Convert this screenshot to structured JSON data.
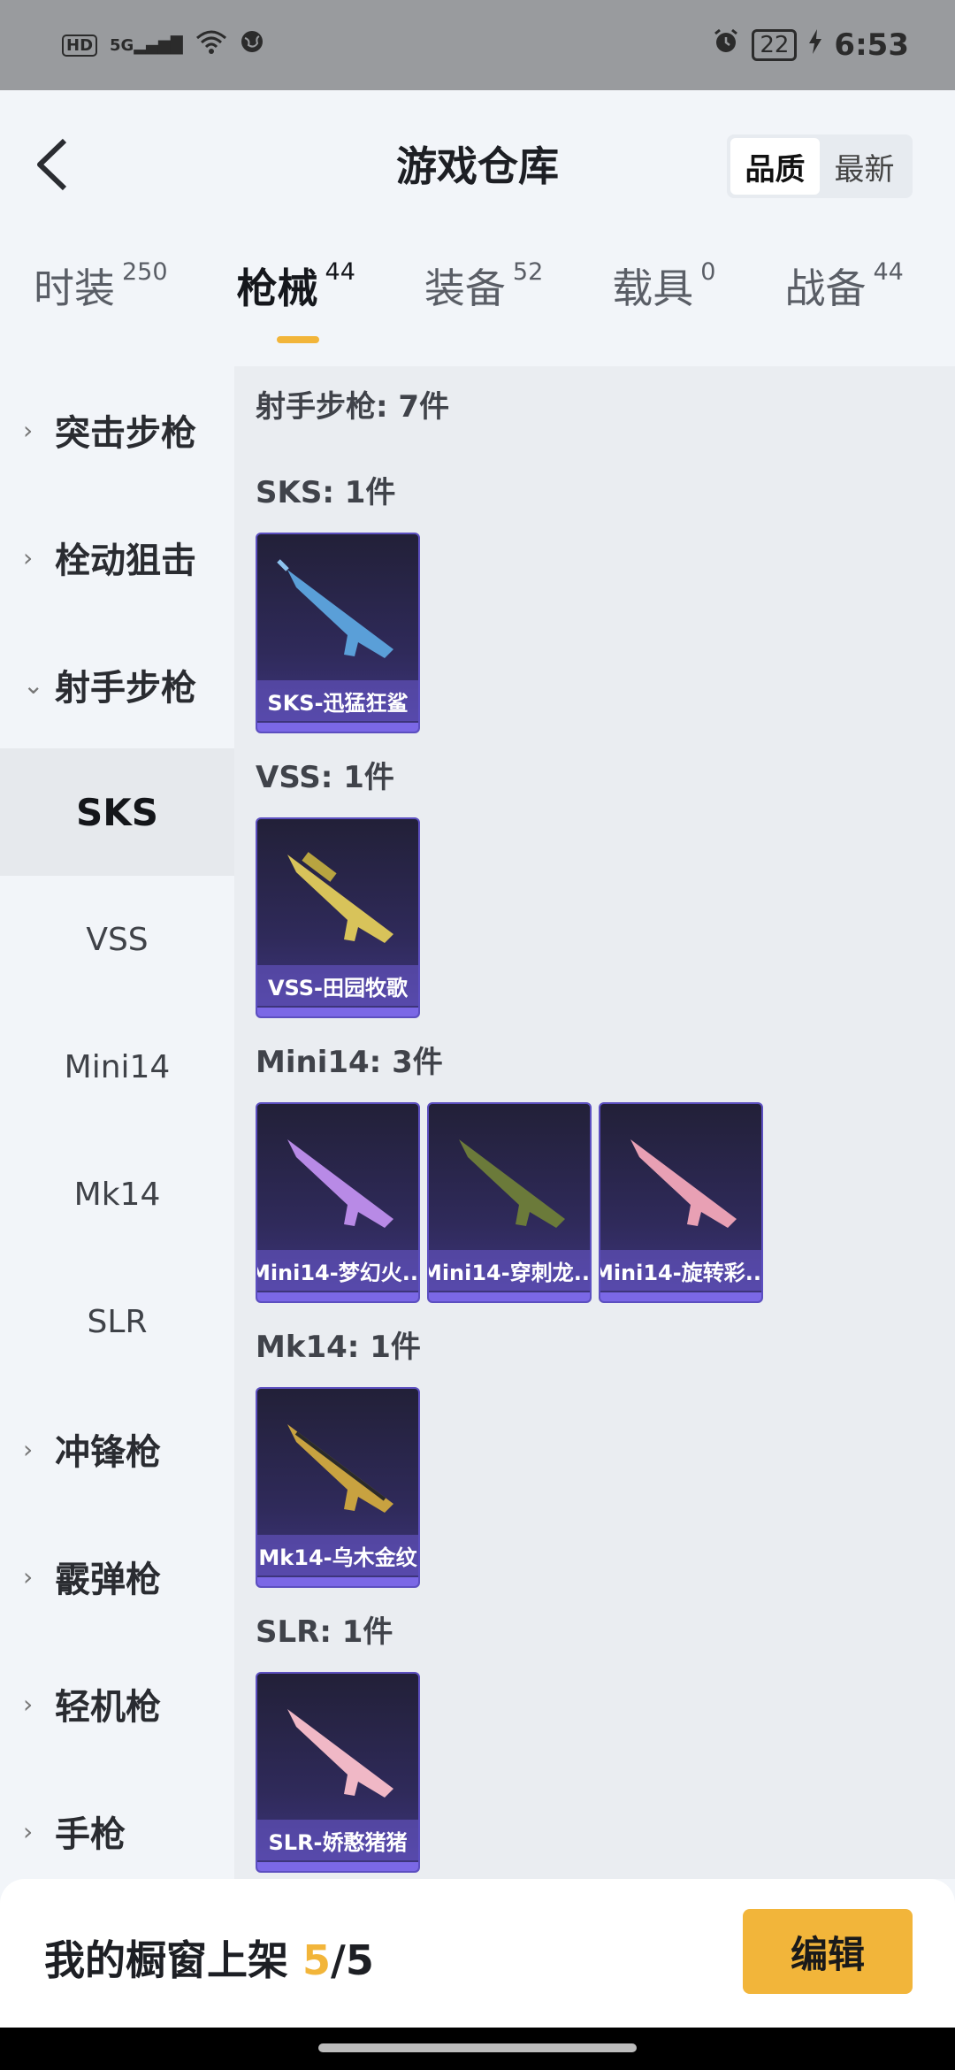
{
  "status_bar": {
    "left_icons": [
      "hd-icon",
      "signal-5g-icon",
      "wifi-icon",
      "globe-icon"
    ],
    "network": "5G",
    "hd": "HD",
    "right_icons": [
      "alarm-icon",
      "battery-icon",
      "charging-icon"
    ],
    "battery": "22",
    "time": "6:53"
  },
  "header": {
    "title": "游戏仓库",
    "sort": {
      "quality": "品质",
      "latest": "最新",
      "selected": "quality"
    }
  },
  "tabs": [
    {
      "label": "时装",
      "count": "250"
    },
    {
      "label": "枪械",
      "count": "44",
      "active": true
    },
    {
      "label": "装备",
      "count": "52"
    },
    {
      "label": "载具",
      "count": "0"
    },
    {
      "label": "战备",
      "count": "44"
    }
  ],
  "sidebar": {
    "categories": [
      {
        "label": "突击步枪"
      },
      {
        "label": "栓动狙击"
      },
      {
        "label": "射手步枪",
        "expanded": true,
        "sub": [
          "SKS",
          "VSS",
          "Mini14",
          "Mk14",
          "SLR"
        ],
        "active_sub": "SKS"
      },
      {
        "label": "冲锋枪"
      },
      {
        "label": "霰弹枪"
      },
      {
        "label": "轻机枪"
      },
      {
        "label": "手枪"
      }
    ]
  },
  "content": {
    "section_title": "射手步枪: 7件",
    "groups": [
      {
        "title": "SKS: 1件",
        "items": [
          {
            "name": "SKS-迅猛狂鲨",
            "color": "#5a9fd8"
          }
        ]
      },
      {
        "title": "VSS: 1件",
        "items": [
          {
            "name": "VSS-田园牧歌",
            "color": "#d8c35a"
          }
        ]
      },
      {
        "title": "Mini14: 3件",
        "items": [
          {
            "name": "Mini14-梦幻火...",
            "color": "#b88ae6"
          },
          {
            "name": "Mini14-穿刺龙...",
            "color": "#6b7a3a"
          },
          {
            "name": "Mini14-旋转彩...",
            "color": "#e8a0b4"
          }
        ]
      },
      {
        "title": "Mk14: 1件",
        "items": [
          {
            "name": "Mk14-乌木金纹",
            "color": "#c8a240"
          }
        ]
      },
      {
        "title": "SLR: 1件",
        "items": [
          {
            "name": "SLR-娇憨猪猪",
            "color": "#f0b8c6"
          }
        ]
      }
    ]
  },
  "bottom": {
    "showcase_prefix": "我的橱窗上架 ",
    "showcase_count": "5",
    "showcase_total": "/5",
    "edit_label": "编辑"
  },
  "colors": {
    "accent": "#f2b53a",
    "card_purple": "#3f3680"
  }
}
